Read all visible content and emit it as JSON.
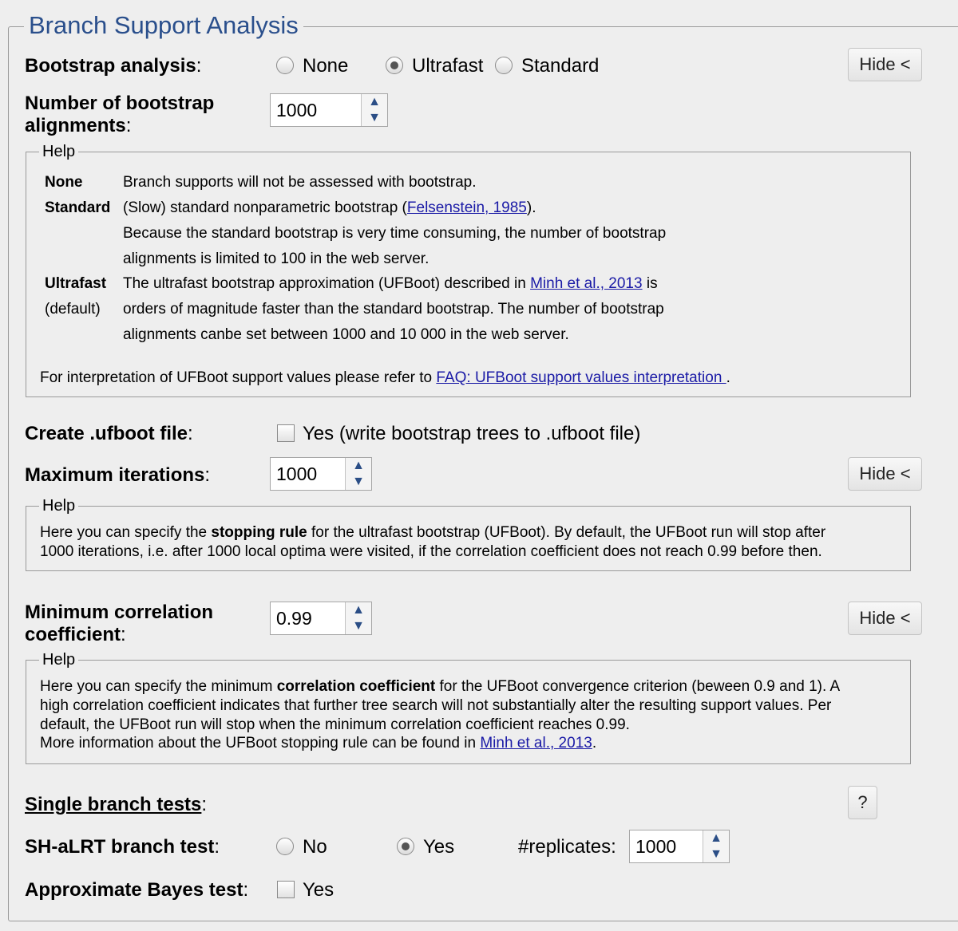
{
  "section_title": "Branch Support Analysis",
  "bootstrap": {
    "label": "Bootstrap analysis",
    "options": [
      "None",
      "Ultrafast",
      "Standard"
    ],
    "selected": "Ultrafast",
    "hide_label": "Hide <"
  },
  "num_bootstrap": {
    "label_line1": "Number of bootstrap",
    "label_line2": "alignments",
    "value": "1000"
  },
  "help1": {
    "title": "Help",
    "none_term": "None",
    "none_desc": "Branch supports will not be assessed with bootstrap.",
    "standard_term": "Standard",
    "standard_desc_pre": "(Slow) standard nonparametric bootstrap (",
    "standard_ref": "Felsenstein, 1985",
    "standard_desc_post": ").",
    "standard_desc2": "Because the standard bootstrap is very time consuming, the number of bootstrap",
    "standard_desc3": "alignments is limited to 100 in the web server.",
    "ultrafast_term": "Ultrafast",
    "default_term": "(default)",
    "ultrafast_desc_pre": "The ultrafast bootstrap approximation (UFBoot) described in ",
    "ultrafast_ref": "Minh et al., 2013",
    "ultrafast_desc_post": " is",
    "ultrafast_desc2": "orders of magnitude faster than the standard bootstrap. The number of bootstrap",
    "ultrafast_desc3": "alignments canbe set between 1000 and 10 000 in the web server.",
    "interp_pre": "For interpretation of UFBoot support values please refer to ",
    "interp_link": "FAQ: UFBoot support values interpretation ",
    "interp_post": "."
  },
  "ufboot_file": {
    "label": "Create .ufboot file",
    "option": "Yes (write bootstrap trees to .ufboot file)",
    "checked": false
  },
  "max_iter": {
    "label": "Maximum iterations",
    "value": "1000",
    "hide_label": "Hide <"
  },
  "help2": {
    "title": "Help",
    "line1_pre": "Here you can specify the ",
    "line1_bold": "stopping rule",
    "line1_post": " for the ultrafast bootstrap (UFBoot). By default, the UFBoot run will stop after",
    "line2": "1000 iterations, i.e. after 1000 local optima were visited, if the correlation coefficient does not reach 0.99 before then."
  },
  "min_corr": {
    "label_line1": "Minimum correlation",
    "label_line2": "coefficient",
    "value": "0.99",
    "hide_label": "Hide <"
  },
  "help3": {
    "title": "Help",
    "line1_pre": "Here you can specify the minimum ",
    "line1_bold": "correlation coefficient",
    "line1_post": " for the UFBoot convergence criterion (beween 0.9 and 1). A",
    "line2": "high correlation coefficient indicates that further tree search will not substantially alter the resulting support values. Per",
    "line3": "default, the UFBoot run will stop when the minimum correlation coefficient reaches 0.99.",
    "line4_pre": "More information about the UFBoot stopping rule can be found in ",
    "line4_ref": "Minh et al., 2013",
    "line4_post": "."
  },
  "single_branch": {
    "label": "Single branch tests",
    "help_button": "?"
  },
  "sh_alrt": {
    "label": "SH-aLRT branch test",
    "options": [
      "No",
      "Yes"
    ],
    "selected": "Yes",
    "replicates_label": "#replicates:",
    "replicates_value": "1000"
  },
  "abayes": {
    "label": "Approximate Bayes test",
    "option": "Yes",
    "checked": false
  },
  "colon": ":"
}
